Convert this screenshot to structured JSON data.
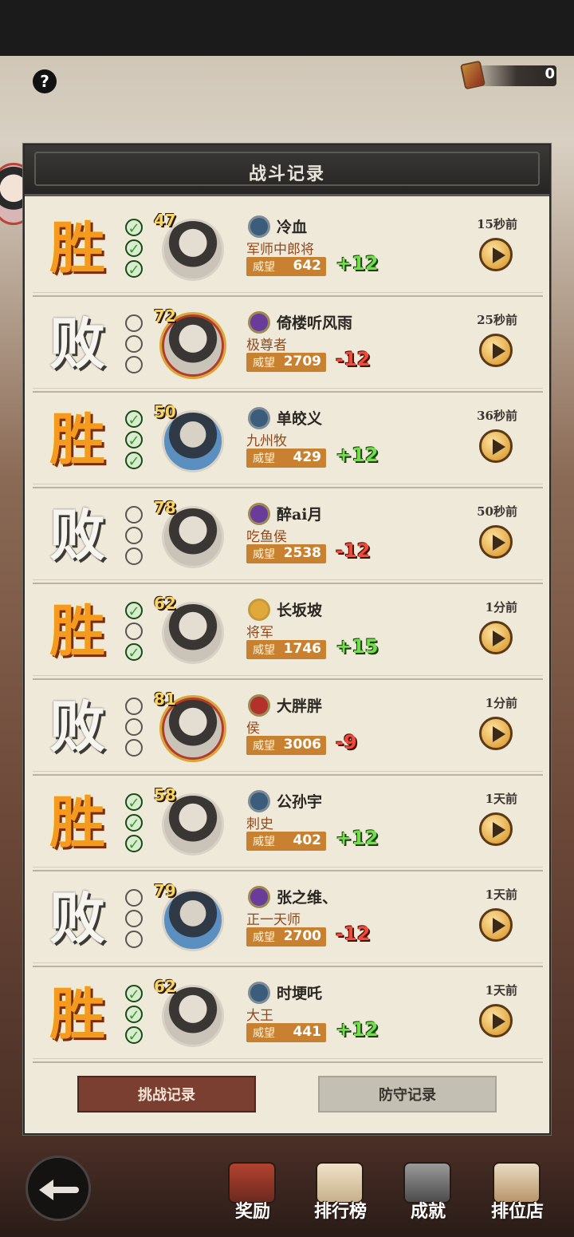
{
  "currency": {
    "amount": "0"
  },
  "panel": {
    "title": "战斗记录"
  },
  "records": [
    {
      "result": "胜",
      "win": true,
      "checks": [
        true,
        true,
        true
      ],
      "level": "47",
      "name": "冷血",
      "title": "军师中郎将",
      "prestige_label": "威望",
      "prestige": "642",
      "delta": "+12",
      "time": "15秒前",
      "rank": "blue"
    },
    {
      "result": "败",
      "win": false,
      "checks": [
        false,
        false,
        false
      ],
      "level": "72",
      "name": "倚楼听风雨",
      "title": "极尊者",
      "prestige_label": "威望",
      "prestige": "2709",
      "delta": "-12",
      "time": "25秒前",
      "rank": "purple"
    },
    {
      "result": "胜",
      "win": true,
      "checks": [
        true,
        true,
        true
      ],
      "level": "50",
      "name": "单皎义",
      "title": "九州牧",
      "prestige_label": "威望",
      "prestige": "429",
      "delta": "+12",
      "time": "36秒前",
      "rank": "blue"
    },
    {
      "result": "败",
      "win": false,
      "checks": [
        false,
        false,
        false
      ],
      "level": "78",
      "name": "醉ai月",
      "title": "吃鱼侯",
      "prestige_label": "威望",
      "prestige": "2538",
      "delta": "-12",
      "time": "50秒前",
      "rank": "purple"
    },
    {
      "result": "胜",
      "win": true,
      "checks": [
        true,
        false,
        true
      ],
      "level": "62",
      "name": "长坂坡",
      "title": "将军",
      "prestige_label": "威望",
      "prestige": "1746",
      "delta": "+15",
      "time": "1分前",
      "rank": "gold"
    },
    {
      "result": "败",
      "win": false,
      "checks": [
        false,
        false,
        false
      ],
      "level": "81",
      "name": "大胖胖",
      "title": "侯",
      "prestige_label": "威望",
      "prestige": "3006",
      "delta": "-9",
      "time": "1分前",
      "rank": "red"
    },
    {
      "result": "胜",
      "win": true,
      "checks": [
        true,
        true,
        true
      ],
      "level": "58",
      "name": "公孙宇",
      "title": "刺史",
      "prestige_label": "威望",
      "prestige": "402",
      "delta": "+12",
      "time": "1天前",
      "rank": "blue"
    },
    {
      "result": "败",
      "win": false,
      "checks": [
        false,
        false,
        false
      ],
      "level": "79",
      "name": "张之维、",
      "title": "正一天师",
      "prestige_label": "威望",
      "prestige": "2700",
      "delta": "-12",
      "time": "1天前",
      "rank": "purple"
    },
    {
      "result": "胜",
      "win": true,
      "checks": [
        true,
        true,
        true
      ],
      "level": "62",
      "name": "时埂吒",
      "title": "大王",
      "prestige_label": "威望",
      "prestige": "441",
      "delta": "+12",
      "time": "1天前",
      "rank": "blue"
    }
  ],
  "tabs": {
    "challenge": "挑战记录",
    "defense": "防守记录"
  },
  "bottom_nav": [
    {
      "label": "奖励",
      "icon": "reward-chest-icon"
    },
    {
      "label": "排行榜",
      "icon": "leaderboard-icon"
    },
    {
      "label": "成就",
      "icon": "achievement-icon"
    },
    {
      "label": "排位店",
      "icon": "ranked-shop-icon"
    }
  ],
  "colors": {
    "win": "#f39a1f",
    "plus": "#6fe04a",
    "minus": "#f24a3a",
    "prestige_bg": "#c88131",
    "active_tab": "#7a3f31"
  }
}
